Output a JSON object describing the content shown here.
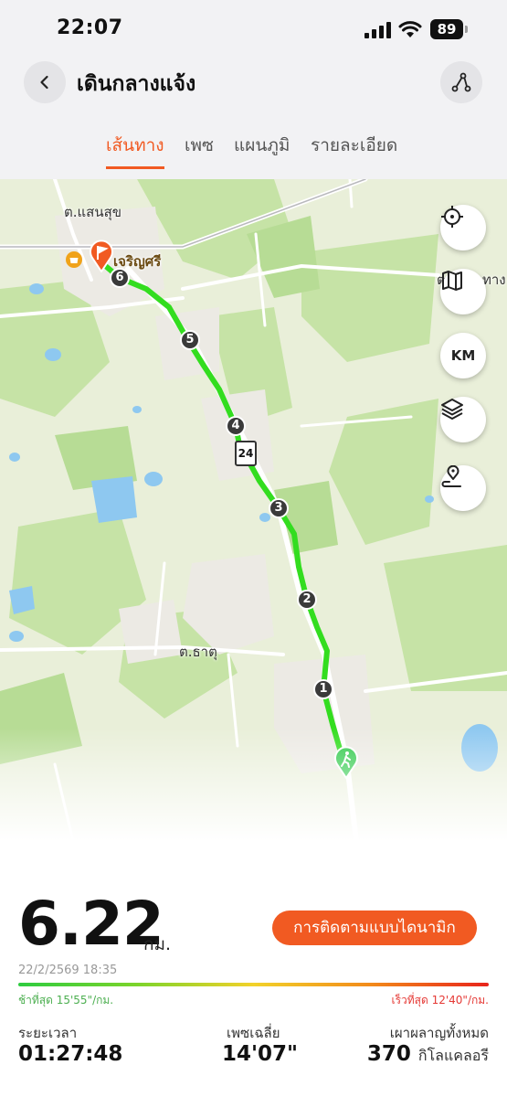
{
  "status_bar": {
    "time": "22:07",
    "battery": "89"
  },
  "header": {
    "title": "เดินกลางแจ้ง"
  },
  "tabs": [
    {
      "label": "เส้นทาง",
      "active": true
    },
    {
      "label": "เพซ",
      "active": false
    },
    {
      "label": "แผนภูมิ",
      "active": false
    },
    {
      "label": "รายละเอียด",
      "active": false
    }
  ],
  "map": {
    "labels": {
      "place_1": "ต.แสนสุข",
      "place_2": "เจริญศรี",
      "place_3": "ต.ธาตุ",
      "place_4": "ต.",
      "place_5": "ทาง"
    },
    "km_markers": [
      "1",
      "2",
      "3",
      "4",
      "5",
      "6"
    ],
    "road_sign": "24",
    "buttons": {
      "km": "KM"
    },
    "route_color": "#33dd1f",
    "flag_color": "#f15a22"
  },
  "stats": {
    "distance": "6.22",
    "distance_unit": "กม.",
    "dynamic_button": "การติดตามแบบไดนามิก",
    "date": "22/2/2569 18:35",
    "slowest": "ช้าที่สุด 15'55\"/กม.",
    "fastest": "เร็วที่สุด 12'40\"/กม.",
    "duration_label": "ระยะเวลา",
    "duration_value": "01:27:48",
    "pace_label": "เพซเฉลี่ย",
    "pace_value": "14'07\"",
    "calories_label": "เผาผลาญทั้งหมด",
    "calories_value": "370",
    "calories_unit": "กิโลแคลอรี"
  }
}
